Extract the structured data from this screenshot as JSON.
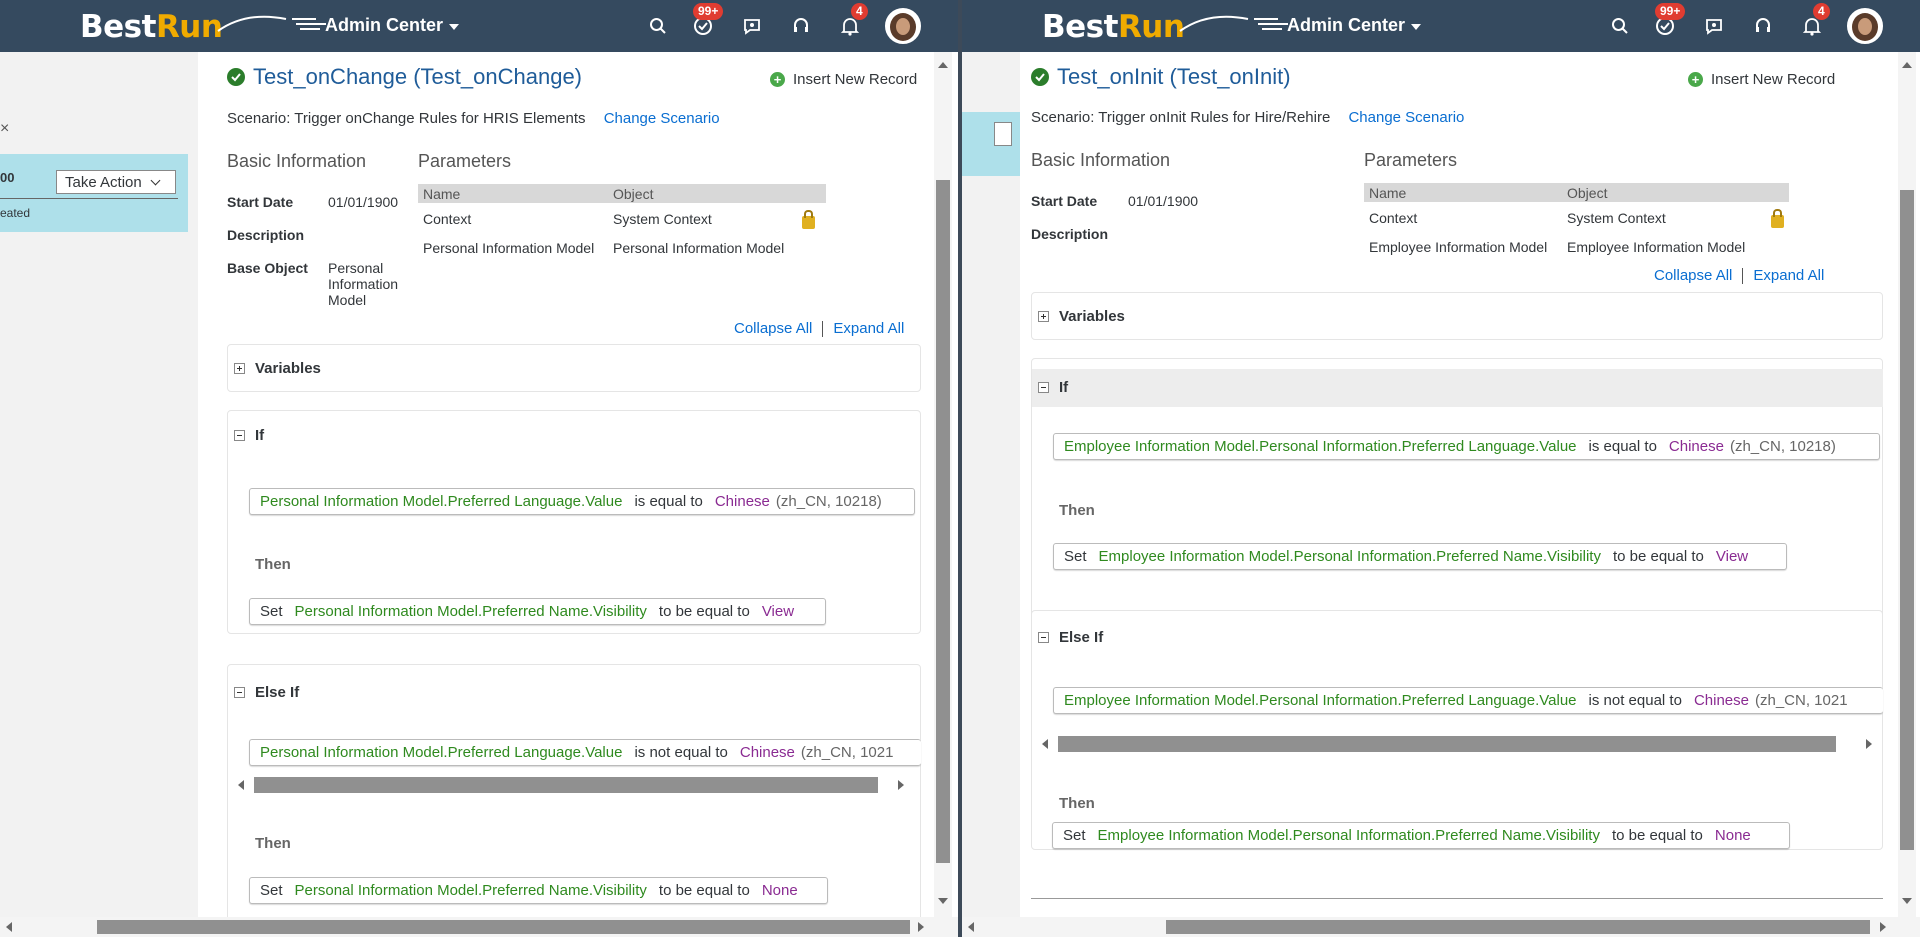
{
  "header": {
    "logo_best": "Best",
    "logo_run": "Run",
    "admin_center": "Admin Center",
    "todo_badge": "99+",
    "notif_badge": "4",
    "icons": [
      "search-icon",
      "todo-icon",
      "chat-icon",
      "support-icon",
      "bell-icon"
    ]
  },
  "background": {
    "take_action": "Take Action",
    "card_number": "00",
    "card_status": "eated",
    "close_glyph": "×"
  },
  "left_dialog": {
    "title": "Test_onChange (Test_onChange)",
    "insert_label": "Insert New Record",
    "scenario_label": "Scenario: Trigger onChange Rules for HRIS Elements",
    "change_scenario": "Change Scenario",
    "basic_info_heading": "Basic Information",
    "parameters_heading": "Parameters",
    "start_date_label": "Start Date",
    "start_date_value": "01/01/1900",
    "description_label": "Description",
    "base_object_label": "Base Object",
    "base_object_value": [
      "Personal",
      "Information",
      "Model"
    ],
    "param_header": {
      "name": "Name",
      "object": "Object"
    },
    "params": [
      {
        "name": "Context",
        "object": "System Context",
        "locked": true
      },
      {
        "name": "Personal Information Model",
        "object": "Personal Information Model",
        "locked": false
      }
    ],
    "collapse_all": "Collapse All",
    "expand_all": "Expand All",
    "variables": "Variables",
    "if_label": "If",
    "if_expr": {
      "field": "Personal Information Model.Preferred Language.Value",
      "op": "is equal to",
      "value": "Chinese",
      "detail": "(zh_CN, 10218)"
    },
    "then_label": "Then",
    "then_expr": {
      "set": "Set",
      "field": "Personal Information Model.Preferred Name.Visibility",
      "op": "to be equal to",
      "value": "View"
    },
    "else_if_label": "Else If",
    "elseif_expr": {
      "field": "Personal Information Model.Preferred Language.Value",
      "op": "is not equal to",
      "value": "Chinese",
      "detail": "(zh_CN, 1021"
    },
    "then2_label": "Then",
    "then2_expr": {
      "set": "Set",
      "field": "Personal Information Model.Preferred Name.Visibility",
      "op": "to be equal to",
      "value": "None"
    }
  },
  "right_dialog": {
    "title": "Test_onInit (Test_onInit)",
    "insert_label": "Insert New Record",
    "scenario_label": "Scenario: Trigger onInit Rules for Hire/Rehire",
    "change_scenario": "Change Scenario",
    "basic_info_heading": "Basic Information",
    "parameters_heading": "Parameters",
    "start_date_label": "Start Date",
    "start_date_value": "01/01/1900",
    "description_label": "Description",
    "param_header": {
      "name": "Name",
      "object": "Object"
    },
    "params": [
      {
        "name": "Context",
        "object": "System Context",
        "locked": true
      },
      {
        "name": "Employee Information Model",
        "object": "Employee Information Model",
        "locked": false
      }
    ],
    "collapse_all": "Collapse All",
    "expand_all": "Expand All",
    "variables": "Variables",
    "if_label": "If",
    "if_expr": {
      "field": "Employee Information Model.Personal Information.Preferred Language.Value",
      "op": "is equal to",
      "value": "Chinese",
      "detail": "(zh_CN, 10218)"
    },
    "then_label": "Then",
    "then_expr": {
      "set": "Set",
      "field": "Employee Information Model.Personal Information.Preferred Name.Visibility",
      "op": "to be equal to",
      "value": "View"
    },
    "else_if_label": "Else If",
    "elseif_expr": {
      "field": "Employee Information Model.Personal Information.Preferred Language.Value",
      "op": "is not equal to",
      "value": "Chinese",
      "detail": "(zh_CN, 1021"
    },
    "then2_label": "Then",
    "then2_expr": {
      "set": "Set",
      "field": "Employee Information Model.Personal Information.Preferred Name.Visibility",
      "op": "to be equal to",
      "value": "None"
    }
  },
  "colors": {
    "shell": "#354a5f",
    "title_blue": "#1f5c99",
    "link_blue": "#0a6ed1",
    "field_green": "#2f8a1f",
    "value_purple": "#8a2b92",
    "badge_red": "#e03c31",
    "card_cyan": "#aee0ea"
  }
}
